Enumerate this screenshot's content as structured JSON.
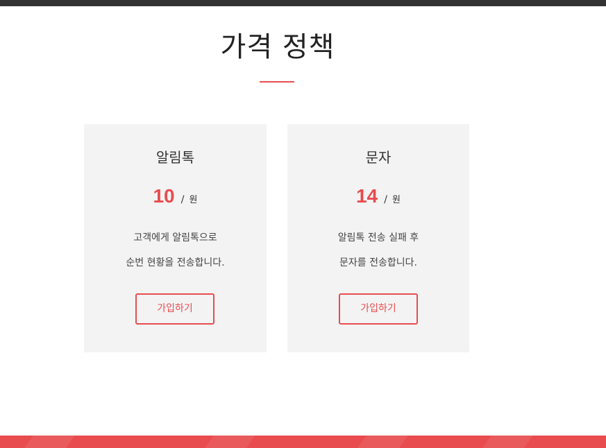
{
  "page": {
    "title": "가격 정책"
  },
  "colors": {
    "accent": "#e84c4f",
    "card_background": "#f3f3f3",
    "top_bar": "#333333"
  },
  "plans": [
    {
      "name": "알림톡",
      "price": "10",
      "separator": "/",
      "unit": "원",
      "description_line1": "고객에게 알림톡으로",
      "description_line2": "순번 현황을 전송합니다.",
      "button_label": "가입하기"
    },
    {
      "name": "문자",
      "price": "14",
      "separator": "/",
      "unit": "원",
      "description_line1": "알림톡 전송 실패 후",
      "description_line2": "문자를 전송합니다.",
      "button_label": "가입하기"
    }
  ]
}
